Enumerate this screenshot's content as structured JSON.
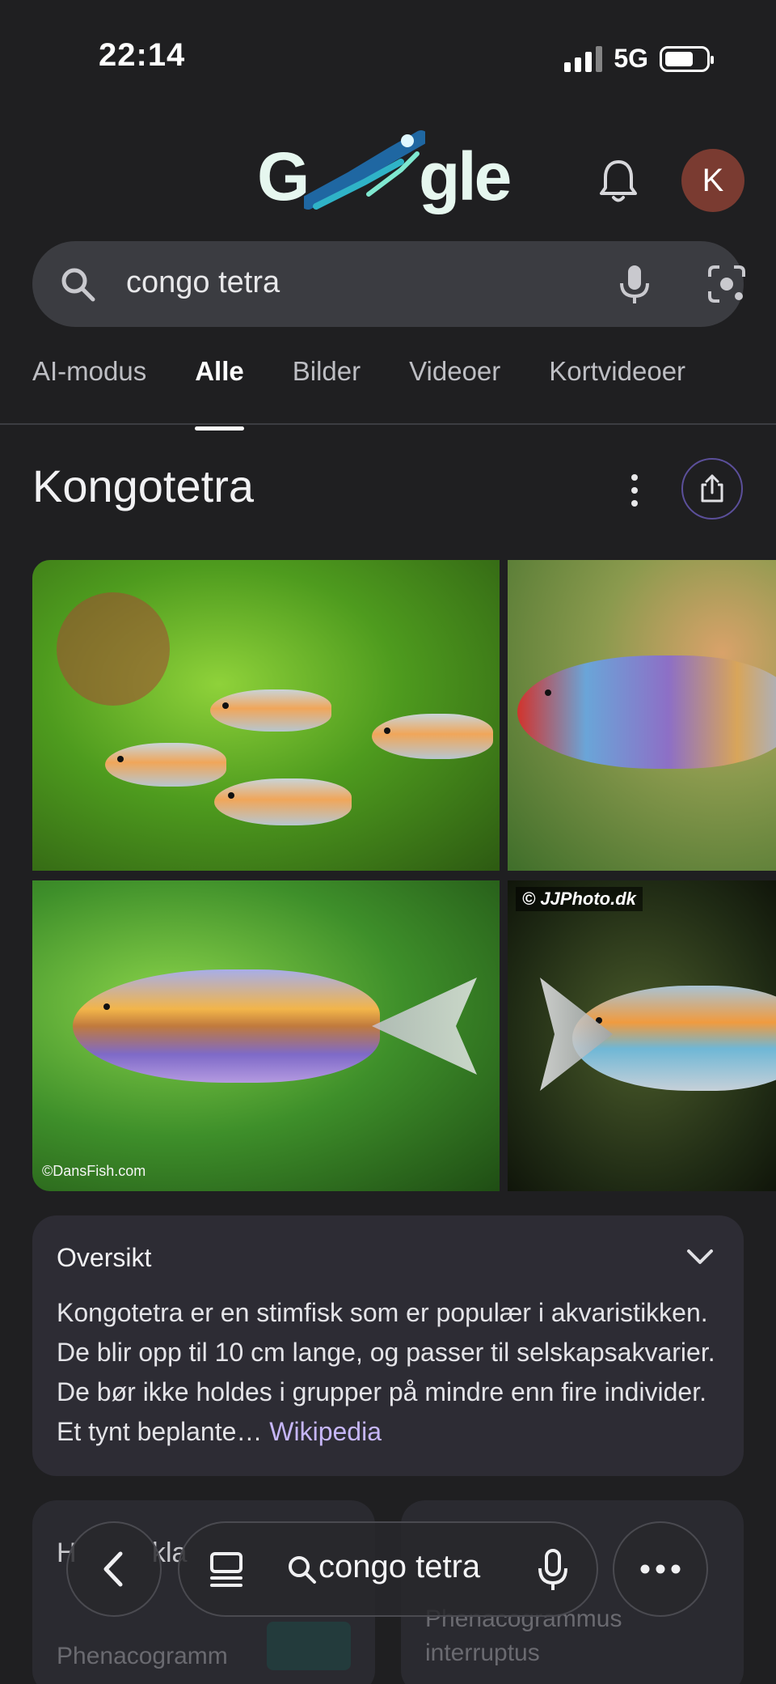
{
  "status_bar": {
    "time": "22:14",
    "network": "5G"
  },
  "header": {
    "logo_text_prefix": "G",
    "logo_text_suffix": "gle",
    "avatar_initial": "K"
  },
  "search": {
    "query": "congo tetra"
  },
  "tabs": [
    {
      "label": "AI-modus",
      "active": false
    },
    {
      "label": "Alle",
      "active": true
    },
    {
      "label": "Bilder",
      "active": false
    },
    {
      "label": "Videoer",
      "active": false
    },
    {
      "label": "Kortvideoer",
      "active": false
    }
  ],
  "knowledge_panel": {
    "title": "Kongotetra",
    "images": [
      {
        "watermark": ""
      },
      {
        "watermark": ""
      },
      {
        "watermark": "©DansFish.com"
      },
      {
        "watermark": "© JJPhoto.dk"
      }
    ],
    "overview": {
      "heading": "Oversikt",
      "text": "Kongotetra er en stimfisk som er populær i akvaristikken. De blir opp til 10 cm lange, og passer til selskapsakvarier. De bør ikke holdes i grupper på mindre enn fire individer. Et tynt beplante…",
      "source_link": "Wikipedia"
    },
    "cards": [
      {
        "title": "H",
        "title_part2": "kla",
        "subtitle": "Phenacogramm"
      },
      {
        "subtitle_line1": "Phenacogrammus",
        "subtitle_line2": "interruptus"
      }
    ]
  },
  "bottom_bar": {
    "query": "congo tetra"
  },
  "colors": {
    "background": "#1f1f21",
    "accent_link": "#c6b6f8",
    "avatar": "#7a3b31"
  }
}
